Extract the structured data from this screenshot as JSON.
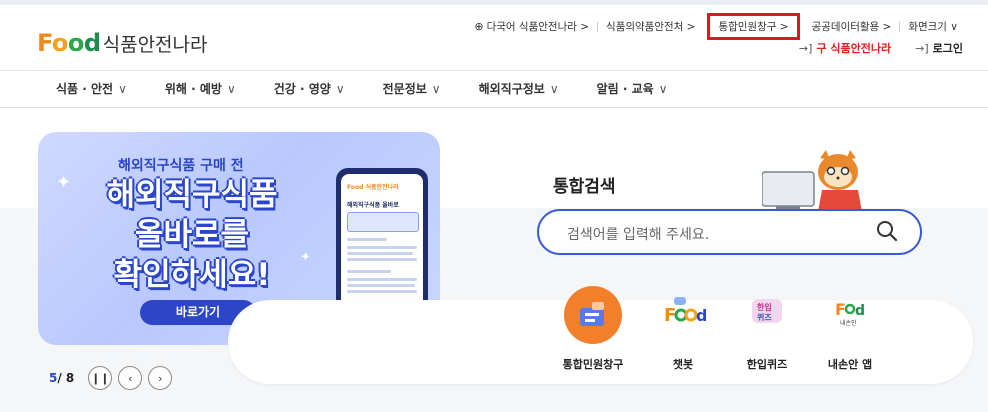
{
  "util_bar": {
    "multilang": "다국어 식품안전나라 >",
    "mfds": "식품의약품안전처 >",
    "civil": "통합민원창구 >",
    "opendata": "공공데이터활용 >",
    "screen_size": "화면크기 ∨"
  },
  "logo": {
    "f": "F",
    "o1": "o",
    "o2": "o",
    "d": "d",
    "text": "식품안전나라"
  },
  "account": {
    "old_site": "구 식품안전나라",
    "login": "로그인",
    "link_icon": "→]"
  },
  "gnb": [
    {
      "label": "식품 · 안전"
    },
    {
      "label": "위해 · 예방"
    },
    {
      "label": "건강 · 영양"
    },
    {
      "label": "전문정보"
    },
    {
      "label": "해외직구정보"
    },
    {
      "label": "알림 · 교육"
    }
  ],
  "banner": {
    "subtitle": "해외직구식품 구매 전",
    "headline_1": "해외직구식품",
    "headline_2": "올바로를",
    "headline_3": "확인하세요!",
    "button": "바로가기",
    "phone_logo": "Food 식품안전나라",
    "phone_title": "해외직구식품 올바로"
  },
  "search": {
    "title": "통합검색",
    "placeholder": "검색어를 입력해 주세요."
  },
  "quick_menu": [
    {
      "label": "통합민원창구",
      "icon": "civil-service-icon"
    },
    {
      "label": "챗봇",
      "icon": "chatbot-icon"
    },
    {
      "label": "한입퀴즈",
      "icon": "quiz-icon"
    },
    {
      "label": "내손안 앱",
      "icon": "app-icon"
    }
  ],
  "pager": {
    "current": "5",
    "total": "/ 8"
  },
  "colors": {
    "accent": "#2c46c7",
    "highlight": "#e8131b",
    "brand_orange": "#f08a1c",
    "brand_green": "#27a84a"
  }
}
